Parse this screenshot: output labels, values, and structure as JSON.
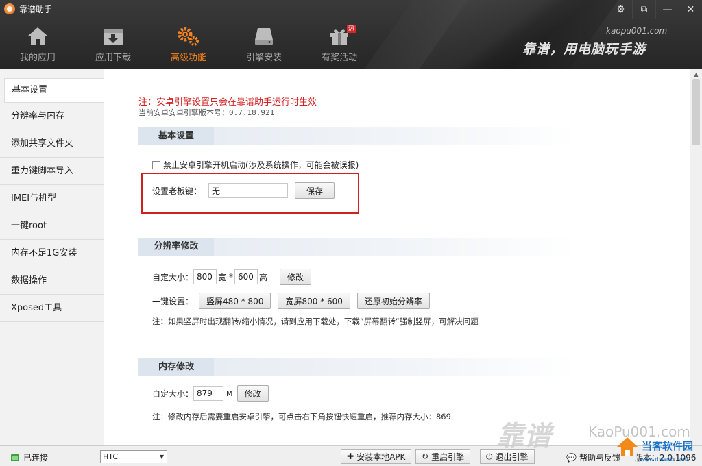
{
  "app": {
    "title": "靠谱助手"
  },
  "window_controls": [
    "⚙",
    "⧉",
    "—",
    "✕"
  ],
  "nav": {
    "items": [
      {
        "label": "我的应用",
        "icon": "home-icon"
      },
      {
        "label": "应用下载",
        "icon": "download-box-icon"
      },
      {
        "label": "高级功能",
        "icon": "gears-icon"
      },
      {
        "label": "引擎安装",
        "icon": "disk-icon"
      },
      {
        "label": "有奖活动",
        "icon": "gift-icon",
        "badge": "热"
      }
    ],
    "active": "高级功能"
  },
  "brand": {
    "url": "kaopu001.com",
    "slogan": "靠谱，用电脑玩手游"
  },
  "sidebar": {
    "items": [
      {
        "label": "基本设置"
      },
      {
        "label": "分辨率与内存"
      },
      {
        "label": "添加共享文件夹"
      },
      {
        "label": "重力键脚本导入"
      },
      {
        "label": "IMEI与机型"
      },
      {
        "label": "一键root"
      },
      {
        "label": "内存不足1G安装"
      },
      {
        "label": "数据操作"
      },
      {
        "label": "Xposed工具"
      }
    ]
  },
  "content": {
    "notice": "注：安卓引擎设置只会在靠谱助手运行时生效",
    "version": "当前安卓安卓引擎版本号：0.7.18.921",
    "basic": {
      "header": "基本设置",
      "checkbox_label": "禁止安卓引擎开机启动(涉及系统操作，可能会被误报)",
      "boss_key_label": "设置老板键：",
      "boss_key_value": "无",
      "save_label": "保存"
    },
    "resolution": {
      "header": "分辨率修改",
      "custom_label": "自定大小：",
      "width": "800",
      "width_unit": "宽",
      "times": "*",
      "height": "600",
      "height_unit": "高",
      "modify_label": "修改",
      "oneclick_label": "一键设置：",
      "preset1": "竖屏480 * 800",
      "preset2": "宽屏800 * 600",
      "reset": "还原初始分辨率",
      "note": "注：如果竖屏时出现翻转/缩小情况，请到应用下载处，下载”屏幕翻转”强制竖屏，可解决问题"
    },
    "memory": {
      "header": "内存修改",
      "custom_label": "自定大小：",
      "value": "879",
      "unit": "M",
      "modify_label": "修改",
      "note": "注：修改内存后需要重启安卓引擎，可点击右下角按钮快速重启，推荐内存大小：869"
    }
  },
  "statusbar": {
    "connected": "已连接",
    "device": "HTC",
    "install_apk": "安装本地APK",
    "restart_engine": "重启引擎",
    "exit_engine": "退出引擎",
    "help": "帮助与反馈",
    "version": "版本：2.0.1096"
  },
  "watermark": {
    "url": "KaoPu001.com",
    "site": "当客软件园",
    "site_url": "www.downkr.com"
  },
  "colors": {
    "accent": "#f5831f",
    "notice_red": "#d0201f",
    "header_bg": "#2e2e2e"
  }
}
